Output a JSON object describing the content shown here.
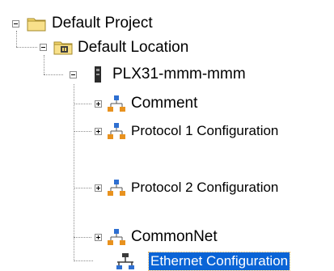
{
  "tree": {
    "project": {
      "label": "Default Project",
      "icon": "folder-icon"
    },
    "location": {
      "label": "Default Location",
      "icon": "location-folder-icon"
    },
    "device": {
      "label": "PLX31-mmm-mmm",
      "icon": "device-icon"
    },
    "children": [
      {
        "label": "Comment",
        "icon": "network-node-icon",
        "expanded": false
      },
      {
        "label": "Protocol 1 Configuration",
        "icon": "network-node-icon",
        "expanded": false
      },
      {
        "label": "Protocol 2 Configuration",
        "icon": "network-node-icon",
        "expanded": false
      },
      {
        "label": "CommonNet",
        "icon": "network-node-icon",
        "expanded": false
      },
      {
        "label": "Ethernet Configuration",
        "icon": "ethernet-icon",
        "selected": true
      }
    ]
  },
  "colors": {
    "selection": "#0a64d6",
    "folder": "#f3d66b",
    "node_orange": "#e8921f",
    "node_blue": "#2e6fd1"
  }
}
